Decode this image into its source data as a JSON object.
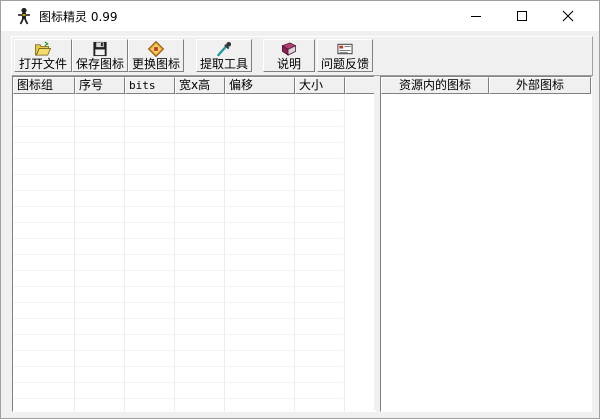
{
  "window": {
    "title": "图标精灵 0.99",
    "controls": {
      "minimize": "minimize",
      "maximize": "maximize",
      "close": "close"
    }
  },
  "toolbar": {
    "buttons": [
      {
        "id": "open",
        "label": "打开文件",
        "icon": "folder-open-icon"
      },
      {
        "id": "save",
        "label": "保存图标",
        "icon": "floppy-disk-icon"
      },
      {
        "id": "replace",
        "label": "更换图标",
        "icon": "replace-icon"
      },
      {
        "id": "extract",
        "label": "提取工具",
        "icon": "eyedropper-icon"
      },
      {
        "id": "help",
        "label": "说明",
        "icon": "book-icon"
      },
      {
        "id": "feedback",
        "label": "问题反馈",
        "icon": "mail-icon"
      }
    ]
  },
  "left_table": {
    "columns": [
      "图标组",
      "序号",
      "bits",
      "宽x高",
      "偏移",
      "大小"
    ]
  },
  "right_table": {
    "columns": [
      "资源内的图标",
      "外部图标"
    ]
  }
}
